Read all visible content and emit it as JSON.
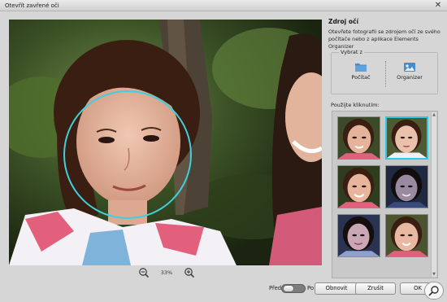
{
  "window": {
    "title": "Otevřít zavřené oči",
    "close_glyph": "✕"
  },
  "photo": {
    "circle_color": "#3fd0dc"
  },
  "zoom": {
    "value": "33%",
    "zoom_out_icon": "zoom-out-icon",
    "zoom_in_icon": "zoom-in-icon"
  },
  "panel": {
    "heading": "Zdroj očí",
    "description": "Otevřete fotografii se zdrojem očí ze svého počítače nebo z aplikace Elements Organizer",
    "select_legend": "Vybrat z",
    "sources": [
      {
        "label": "Počítač",
        "icon": "folder-icon"
      },
      {
        "label": "Organizer",
        "icon": "organizer-photos-icon"
      }
    ],
    "tap_label": "Použijte kliknutím:",
    "thumbnails": [
      {
        "selected": false
      },
      {
        "selected": true
      },
      {
        "selected": false
      },
      {
        "selected": false
      },
      {
        "selected": false
      },
      {
        "selected": false
      }
    ],
    "accent": "#2ec8e0"
  },
  "footer": {
    "before_label": "Před",
    "after_label": "Po",
    "reset_label": "Obnovit",
    "cancel_label": "Zrušit",
    "ok_label": "OK"
  }
}
